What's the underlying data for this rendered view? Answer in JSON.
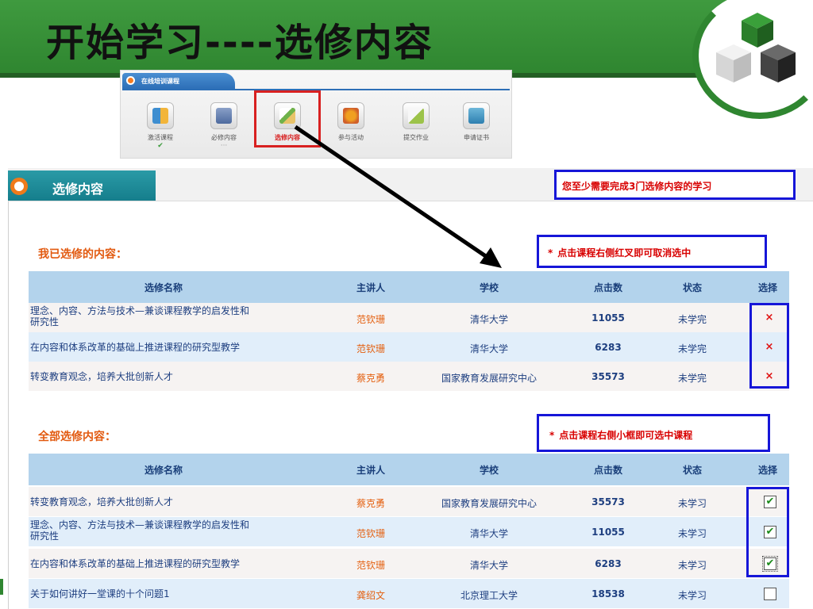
{
  "slide": {
    "title": "开始学习----选修内容"
  },
  "toolbar": {
    "tab_label": "在线培训课程",
    "items": [
      {
        "label": "激活课程",
        "sub": "✔"
      },
      {
        "label": "必修内容",
        "sub": "···"
      },
      {
        "label": "选修内容",
        "sub": ""
      },
      {
        "label": "参与活动",
        "sub": ""
      },
      {
        "label": "提交作业",
        "sub": ""
      },
      {
        "label": "申请证书",
        "sub": ""
      }
    ]
  },
  "panel": {
    "title": "选修内容",
    "notice": "您至少需要完成3门选修内容的学习"
  },
  "selected_section": {
    "title": "我已选修的内容：",
    "hint": "点击课程右侧红叉即可取消选中",
    "hint_star": "*",
    "columns": [
      "选修名称",
      "主讲人",
      "学校",
      "点击数",
      "状态",
      "选择"
    ],
    "rows": [
      {
        "name_line1": "理念、内容、方法与技术—兼谈课程教学的启发性和",
        "name_line2": "研究性",
        "teacher": "范钦珊",
        "school": "清华大学",
        "clicks": "11055",
        "status": "未学完",
        "select": "×"
      },
      {
        "name_line1": "在内容和体系改革的基础上推进课程的研究型教学",
        "name_line2": "",
        "teacher": "范钦珊",
        "school": "清华大学",
        "clicks": "6283",
        "status": "未学完",
        "select": "×"
      },
      {
        "name_line1": "转变教育观念，培养大批创新人才",
        "name_line2": "",
        "teacher": "蔡克勇",
        "school": "国家教育发展研究中心",
        "clicks": "35573",
        "status": "未学完",
        "select": "×"
      }
    ]
  },
  "all_section": {
    "title": "全部选修内容：",
    "hint": "点击课程右侧小框即可选中课程",
    "hint_star": "*",
    "columns": [
      "选修名称",
      "主讲人",
      "学校",
      "点击数",
      "状态",
      "选择"
    ],
    "rows": [
      {
        "name_line1": "转变教育观念，培养大批创新人才",
        "name_line2": "",
        "teacher": "蔡克勇",
        "school": "国家教育发展研究中心",
        "clicks": "35573",
        "status": "未学习",
        "checked": "✔"
      },
      {
        "name_line1": "理念、内容、方法与技术—兼谈课程教学的启发性和",
        "name_line2": "研究性",
        "teacher": "范钦珊",
        "school": "清华大学",
        "clicks": "11055",
        "status": "未学习",
        "checked": "✔"
      },
      {
        "name_line1": "在内容和体系改革的基础上推进课程的研究型教学",
        "name_line2": "",
        "teacher": "范钦珊",
        "school": "清华大学",
        "clicks": "6283",
        "status": "未学习",
        "checked": "✔"
      },
      {
        "name_line1": "关于如何讲好一堂课的十个问题1",
        "name_line2": "",
        "teacher": "龚绍文",
        "school": "北京理工大学",
        "clicks": "18538",
        "status": "未学习",
        "checked": ""
      }
    ]
  },
  "colors": {
    "banner_green": "#2f8630",
    "header_blue": "#b3d3ec",
    "accent_orange": "#e25a10",
    "highlight_blue": "#1616d8",
    "alert_red": "#d80000"
  },
  "icons": [
    "cube-logo-icon",
    "calendar-chart-icon",
    "book-icon",
    "pencil-paper-icon",
    "maple-leaf-icon",
    "homework-pen-icon",
    "graduation-cap-icon",
    "orange-dot-icon",
    "close-x-icon",
    "checkbox-icon"
  ]
}
